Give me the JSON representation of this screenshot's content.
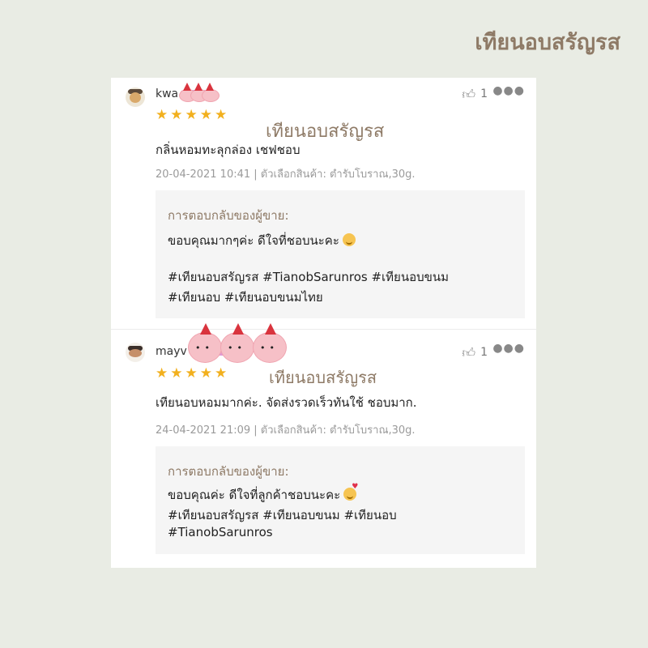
{
  "brand": "เทียนอบสรัญรส",
  "reviews": [
    {
      "username": "kwa",
      "rating": 5,
      "watermark": "เทียนอบสรัญรส",
      "likes": "1",
      "text": "กลิ่นหอมทะลุกล่อง เชฟชอบ",
      "meta": "20-04-2021 10:41 | ตัวเลือกสินค้า: ตำรับโบราณ,30g.",
      "reply": {
        "title": "การตอบกลับของผู้ขาย:",
        "lines": [
          "ขอบคุณมากๆค่ะ ดีใจที่ชอบนะคะ",
          "#เทียนอบสรัญรส #TianobSarunros #เทียนอบขนม",
          "#เทียนอบ #เทียนอบขนมไทย"
        ],
        "emoji": "smiling-face-icon"
      }
    },
    {
      "username": "mayv",
      "rating": 5,
      "watermark": "เทียนอบสรัญรส",
      "likes": "1",
      "text": "เทียนอบหอมมากค่ะ. จัดส่งรวดเร็วทันใช้ ชอบมาก.",
      "meta": "24-04-2021 21:09 | ตัวเลือกสินค้า: ตำรับโบราณ,30g.",
      "reply": {
        "title": "การตอบกลับของผู้ขาย:",
        "lines": [
          "ขอบคุณค่ะ ดีใจที่ลูกค้าชอบนะคะ",
          "#เทียนอบสรัญรส #เทียนอบขนม #เทียนอบ",
          "#TianobSarunros"
        ],
        "emoji": "smiling-face-with-hearts-icon"
      }
    }
  ],
  "icons": {
    "star": "star-icon",
    "like": "thumbs-up-icon",
    "more": "more-dots-icon"
  },
  "colors": {
    "accent": "#8e7a66",
    "star": "#f2b01e",
    "background": "#e9ece4"
  }
}
